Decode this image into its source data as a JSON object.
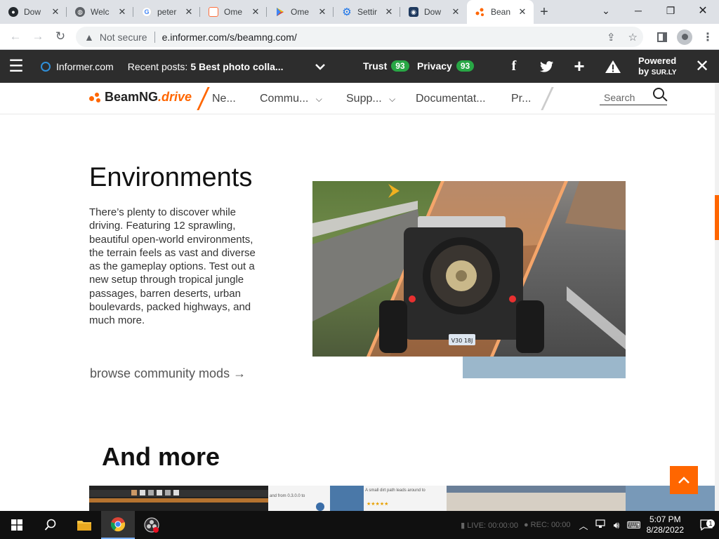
{
  "browser": {
    "tabs": [
      {
        "label": "Dow",
        "icon": "github-icon",
        "color": "#24292e"
      },
      {
        "label": "Welc",
        "icon": "globe-icon",
        "color": "#5f6368"
      },
      {
        "label": "peter",
        "icon": "google-icon",
        "color": "#4285f4"
      },
      {
        "label": "Ome",
        "icon": "ometv-icon",
        "color": "#ff6f3c"
      },
      {
        "label": "Ome",
        "icon": "play-store-icon",
        "color": "#01875f"
      },
      {
        "label": "Settir",
        "icon": "gear-icon",
        "color": "#1a73e8"
      },
      {
        "label": "Dow",
        "icon": "uptodown-icon",
        "color": "#1f3a5f"
      },
      {
        "label": "Bean",
        "icon": "beamng-icon",
        "color": "#ff6600"
      }
    ],
    "new_tab_label": "+",
    "security_label": "Not secure",
    "url": "e.informer.com/s/beamng.com/"
  },
  "informer_bar": {
    "brand": "Informer.com",
    "recent_label": "Recent posts:",
    "recent_title": "5 Best photo colla...",
    "trust_label": "Trust",
    "trust_score": "93",
    "privacy_label": "Privacy",
    "privacy_score": "93",
    "powered_line1": "Powered",
    "powered_line2": "by",
    "powered_brand": "SUR.LY"
  },
  "site": {
    "logo_main": "BeamNG",
    "logo_accent": ".drive",
    "menu": [
      "Ne...",
      "Commu...",
      "Supp...",
      "Documentat...",
      "Pr..."
    ],
    "search_placeholder": "Search",
    "accent_color": "#ff6600"
  },
  "environments": {
    "title": "Environments",
    "body": "There’s plenty to discover while driving. Featuring 12 sprawling, beautiful open-world environments, the terrain feels as vast and diverse as the gameplay options. Test out a new setup through tropical jungle passages, barren deserts, urban boulevards, packed highways, and much more.",
    "link_label": "browse community mods →",
    "plate_text": "V30 18J"
  },
  "more": {
    "title": "And more",
    "strip_texts": [
      "and from 0.3.0.0 to",
      "A small dirt path leads around to",
      "★★★★★"
    ]
  },
  "taskbar": {
    "live_label": "LIVE: 00:00:00",
    "rec_label": "REC: 00:00",
    "time": "5:07 PM",
    "date": "8/28/2022",
    "notification_count": "1"
  }
}
